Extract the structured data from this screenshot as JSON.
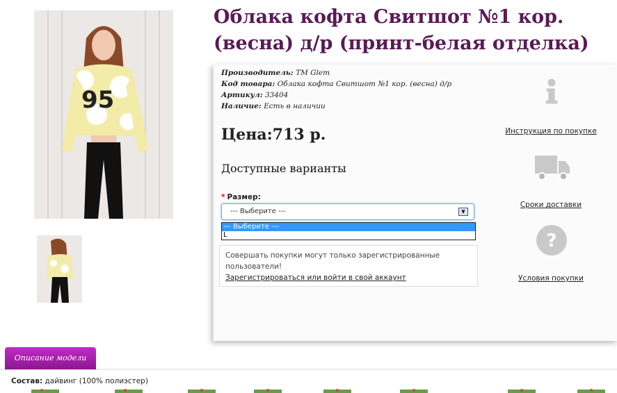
{
  "product": {
    "title": "Облака кофта Свитшот №1 кор. (весна) д/р (принт-белая отделка)",
    "manufacturer_label": "Производитель:",
    "manufacturer": "TM Glem",
    "code_label": "Код товара:",
    "code": "Облака кофта Свитшот №1 кор. (весна) д/р",
    "article_label": "Артикул:",
    "article": "33404",
    "stock_label": "Наличие:",
    "stock": "Есть в наличии",
    "price": "Цена:713 р."
  },
  "options": {
    "heading": "Доступные варианты",
    "size_label": "Размер:",
    "selected": "--- Выберите ---",
    "dropdown": [
      "--- Выберите ---",
      "L"
    ]
  },
  "login": {
    "notice": "Совершать покупки могут только зарегистрированные пользователи!",
    "link": "Зарегистрироваться или войти в свой аккаунт"
  },
  "side_links": {
    "instruction": "Инструкция по покупке",
    "delivery": "Сроки доставки",
    "terms": "Условия покупки"
  },
  "tabs": {
    "description": "Описание модели"
  },
  "description": {
    "composition_label": "Состав:",
    "composition": "дайвинг (100% полиэстер)"
  },
  "colors": {
    "title": "#5a1a55",
    "tab": "#a020a8",
    "select_highlight": "#3399ff"
  },
  "icons": [
    "info-icon",
    "truck-icon",
    "question-icon",
    "dropdown-arrow-icon"
  ]
}
